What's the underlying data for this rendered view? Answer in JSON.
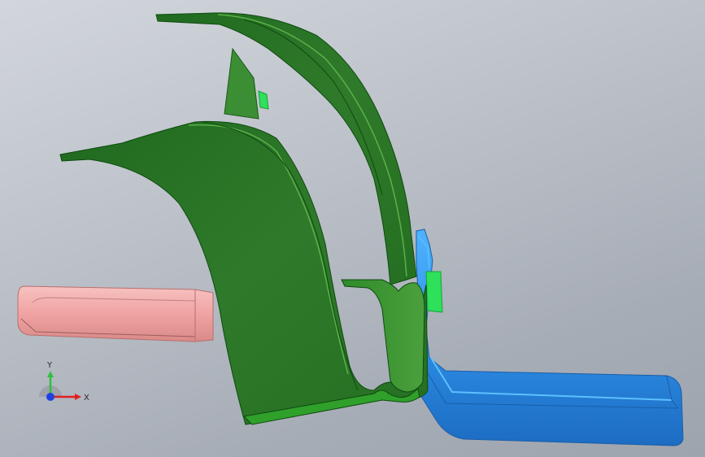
{
  "viewport": {
    "background_top": "#d2d6dc",
    "background_bottom": "#9ea4ad"
  },
  "parts": [
    {
      "name": "fender-part",
      "color": "#2f7a2a"
    },
    {
      "name": "bracket-part-right",
      "color": "#2e8fe6"
    },
    {
      "name": "bracket-part-left",
      "color": "#f0a3a3"
    },
    {
      "name": "clip-part",
      "color": "#2ee05a"
    }
  ],
  "triad": {
    "x_label": "X",
    "y_label": "Y",
    "x_color": "#e02020",
    "y_color": "#30c040",
    "z_color": "#2040e0"
  }
}
